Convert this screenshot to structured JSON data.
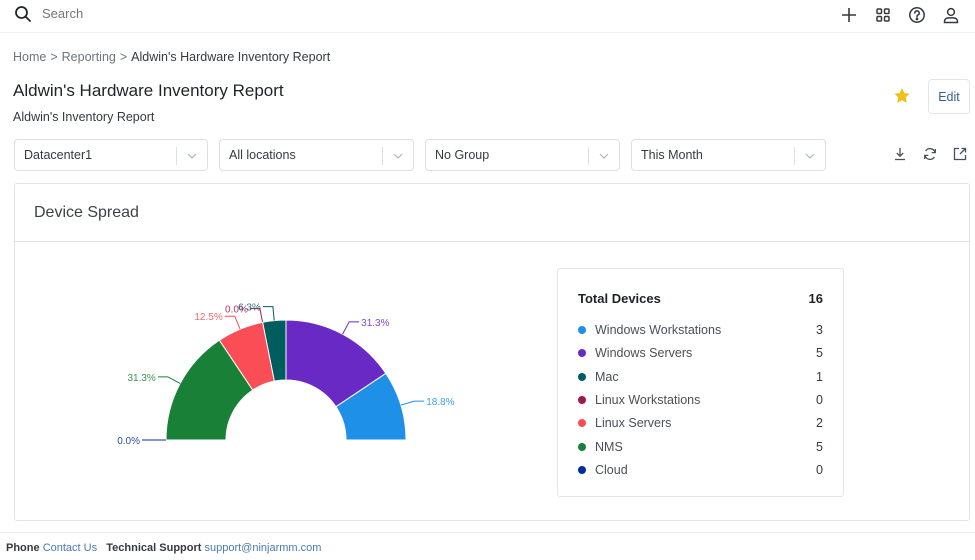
{
  "topbar": {
    "search_placeholder": "Search",
    "icons": [
      "plus-icon",
      "apps-grid-icon",
      "help-icon",
      "user-icon"
    ]
  },
  "breadcrumb": {
    "items": [
      "Home",
      "Reporting",
      "Aldwin's Hardware Inventory Report"
    ],
    "separator": ">"
  },
  "page": {
    "title": "Aldwin's Hardware Inventory Report",
    "subtitle": "Aldwin's Inventory Report",
    "edit_label": "Edit",
    "favorite": true
  },
  "filters": [
    {
      "value": "Datacenter1"
    },
    {
      "value": "All locations"
    },
    {
      "value": "No Group"
    },
    {
      "value": "This Month"
    }
  ],
  "tools": [
    "download-icon",
    "refresh-icon",
    "open-external-icon"
  ],
  "card": {
    "title": "Device Spread"
  },
  "chart_data": {
    "type": "pie",
    "subtype": "half-donut",
    "title": "Device Spread",
    "total_label": "Total Devices",
    "total": 16,
    "slices": [
      {
        "name": "Windows Workstations",
        "value": 3,
        "pct_label": "18.8%",
        "color": "#1e90e8"
      },
      {
        "name": "Windows Servers",
        "value": 5,
        "pct_label": "31.3%",
        "color": "#6929c4"
      },
      {
        "name": "Mac",
        "value": 1,
        "pct_label": "6.3%",
        "color": "#005d5d"
      },
      {
        "name": "Linux Workstations",
        "value": 0,
        "pct_label": "0.0%",
        "color": "#9f1853"
      },
      {
        "name": "Linux Servers",
        "value": 2,
        "pct_label": "12.5%",
        "color": "#fa4d56"
      },
      {
        "name": "NMS",
        "value": 5,
        "pct_label": "31.3%",
        "color": "#198038"
      },
      {
        "name": "Cloud",
        "value": 0,
        "pct_label": "0.0%",
        "color": "#002d9c"
      }
    ],
    "legend_position": "right"
  },
  "footer": {
    "phone_label": "Phone",
    "phone_link": "Contact Us",
    "support_label": "Technical Support",
    "support_link": "support@ninjarmm.com"
  }
}
